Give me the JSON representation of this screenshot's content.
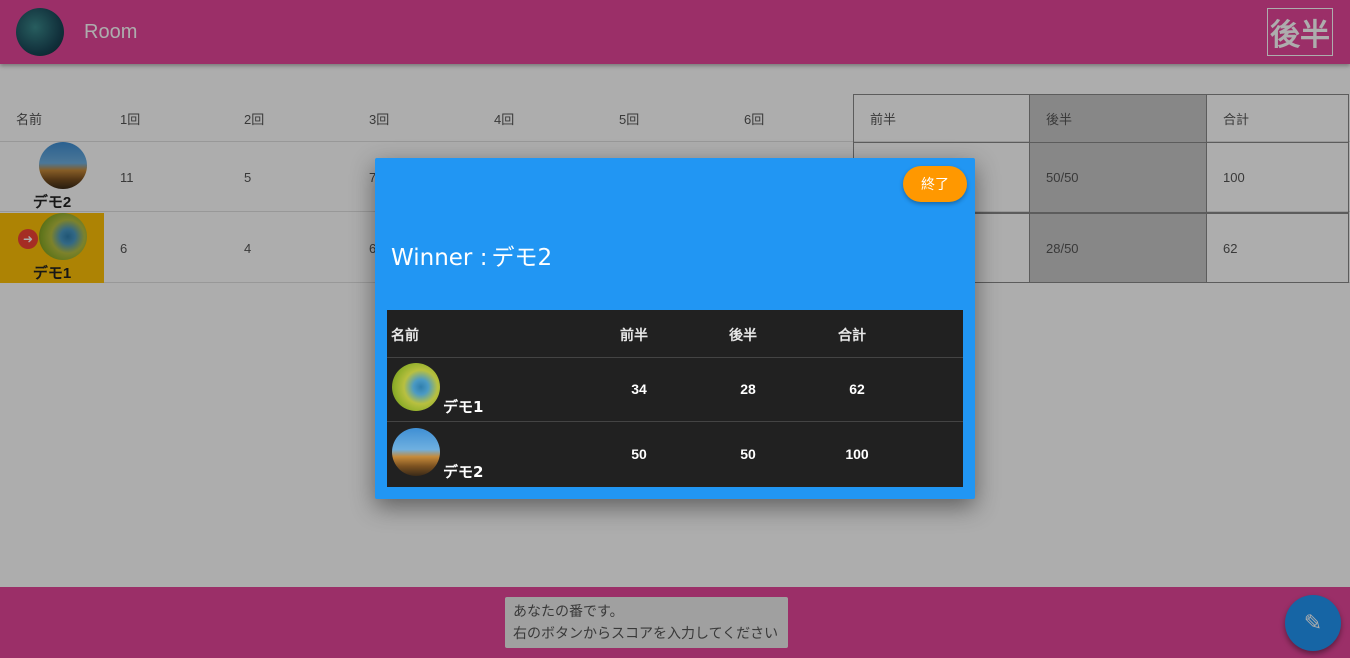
{
  "header": {
    "title": "Room",
    "half_label": "後半"
  },
  "table": {
    "headers": [
      "名前",
      "1回",
      "2回",
      "3回",
      "4回",
      "5回",
      "6回",
      "前半",
      "後半",
      "合計"
    ],
    "players": [
      {
        "name": "デモ2",
        "scores": [
          "11",
          "5",
          "7"
        ],
        "first_half": "",
        "second_half": "50/50",
        "total": "100"
      },
      {
        "name": "デモ1",
        "scores": [
          "6",
          "4",
          "6"
        ],
        "first_half": "",
        "second_half": "28/50",
        "total": "62"
      }
    ]
  },
  "dialog": {
    "end_button": "終了",
    "winner_label": "Winner :",
    "winner_name": "デモ2",
    "result_headers": [
      "名前",
      "前半",
      "後半",
      "合計"
    ],
    "results": [
      {
        "name": "デモ1",
        "first_half": "34",
        "second_half": "28",
        "total": "62"
      },
      {
        "name": "デモ2",
        "first_half": "50",
        "second_half": "50",
        "total": "100"
      }
    ]
  },
  "footer": {
    "toast_line1": "あなたの番です。",
    "toast_line2": "右のボタンからスコアを入力してください"
  },
  "icons": {
    "turn": "arrow-right-icon",
    "fab": "pencil-icon"
  },
  "colors": {
    "header": "#e5469a",
    "dialog": "#2196f3",
    "end_button": "#ff9800",
    "active_player": "#ffc107"
  }
}
